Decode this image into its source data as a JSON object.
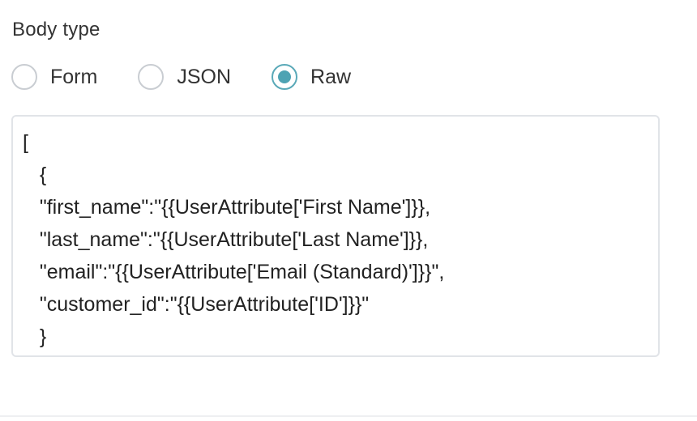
{
  "body_type": {
    "label": "Body type",
    "options": [
      {
        "label": "Form",
        "checked": false
      },
      {
        "label": "JSON",
        "checked": false
      },
      {
        "label": "Raw",
        "checked": true
      }
    ],
    "accent_color": "#4ea3b3"
  },
  "body_content": "[\n   {\n   \"first_name\":\"{{UserAttribute['First Name']}},\n   \"last_name\":\"{{UserAttribute['Last Name']}},\n   \"email\":\"{{UserAttribute['Email (Standard)']}}\",\n   \"customer_id\":\"{{UserAttribute['ID']}}\"\n   }"
}
